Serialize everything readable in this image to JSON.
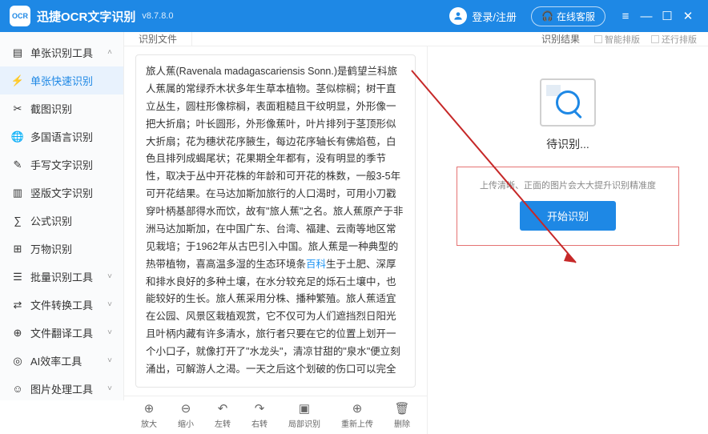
{
  "header": {
    "appName": "迅捷OCR文字识别",
    "version": "v8.7.8.0",
    "login": "登录/注册",
    "online": "在线客服"
  },
  "sidebar": {
    "items": [
      {
        "icon": "▤",
        "label": "单张识别工具",
        "head": true,
        "exp": "˄"
      },
      {
        "icon": "⚡",
        "label": "单张快速识别",
        "active": true
      },
      {
        "icon": "✂",
        "label": "截图识别"
      },
      {
        "icon": "🌐",
        "label": "多国语言识别"
      },
      {
        "icon": "✎",
        "label": "手写文字识别"
      },
      {
        "icon": "▥",
        "label": "竖版文字识别"
      },
      {
        "icon": "∑",
        "label": "公式识别"
      },
      {
        "icon": "⊞",
        "label": "万物识别"
      },
      {
        "icon": "☰",
        "label": "批量识别工具",
        "head": true,
        "exp": "˅"
      },
      {
        "icon": "⇄",
        "label": "文件转换工具",
        "head": true,
        "exp": "˅"
      },
      {
        "icon": "⊕",
        "label": "文件翻译工具",
        "head": true,
        "exp": "˅"
      },
      {
        "icon": "◎",
        "label": "AI效率工具",
        "head": true,
        "exp": "˅"
      },
      {
        "icon": "☺",
        "label": "图片处理工具",
        "head": true,
        "exp": "˅"
      }
    ]
  },
  "tabs": {
    "left": "识别文件",
    "right": "识别结果",
    "opt1": "智能排版",
    "opt2": "还行排版"
  },
  "document": {
    "text": "旅人蕉(Ravenala madagascariensis Sonn.)是鹤望兰科旅人蕉属的常绿乔木状多年生草本植物。茎似棕榈；树干直立丛生，圆柱形像棕榈，表面粗糙且干纹明显，外形像一把大折扇；叶长圆形，外形像蕉叶，叶片排列于茎顶形似大折扇；花为穗状花序腋生，每边花序轴长有佛焰苞，白色且排列成蝎尾状；花果期全年都有，没有明显的季节性，取决于丛中开花株的年龄和可开花的株数，一般3-5年可开花结果。在马达加斯加旅行的人口渴时，可用小刀戳穿叶柄基部得水而饮，故有\"旅人蕉\"之名。旅人蕉原产于非洲马达加斯加，在中国广东、台湾、福建、云南等地区常见栽培；于1962年从古巴引入中国。旅人蕉是一种典型的热带植物，喜高温多湿的生态环境条",
    "baike": "百科",
    "text2": "生于土肥、深厚和排水良好的多种土壤，在水分较充足的烁石土壤中，也能较好的生长。旅人蕉采用分株、播种繁殖。旅人蕉适宜在公园、风景区栽植观赏，它不仅可为人们遮挡烈日阳光且叶柄内藏有许多清水，旅行者只要在它的位置上划开一个小口子，就像打开了\"水龙头\"，清凉甘甜的\"泉水\"便立刻涌出，可解游人之渴。一天之后这个划破的伤口可以完全"
  },
  "toolbar": [
    {
      "icon": "⊕",
      "label": "放大"
    },
    {
      "icon": "⊖",
      "label": "缩小"
    },
    {
      "icon": "↶",
      "label": "左转"
    },
    {
      "icon": "↷",
      "label": "右转"
    },
    {
      "icon": "▣",
      "label": "局部识别"
    },
    {
      "icon": "⊕",
      "label": "重新上传"
    },
    {
      "icon": "🗑",
      "label": "删除"
    }
  ],
  "result": {
    "waiting": "待识别...",
    "hint": "上传清晰、正面的图片会大大提升识别精准度",
    "start": "开始识别"
  }
}
